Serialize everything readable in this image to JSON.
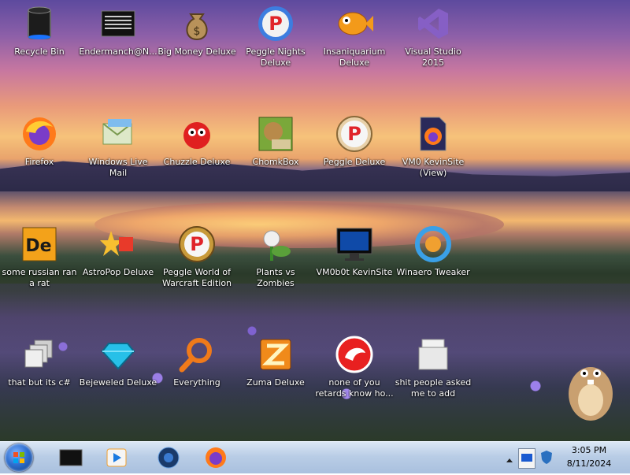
{
  "desktop": {
    "icons": [
      {
        "label": "Recycle Bin"
      },
      {
        "label": "Endermanch@N..."
      },
      {
        "label": "Big Money Deluxe"
      },
      {
        "label": "Peggle Nights Deluxe"
      },
      {
        "label": "Insaniquarium Deluxe"
      },
      {
        "label": "Visual Studio 2015"
      },
      {
        "label": "Firefox"
      },
      {
        "label": "Windows Live Mail"
      },
      {
        "label": "Chuzzle Deluxe"
      },
      {
        "label": "ChomkBox"
      },
      {
        "label": "Peggle Deluxe"
      },
      {
        "label": "VM0 KevinSite (View)"
      },
      {
        "label": "some russian ran a rat"
      },
      {
        "label": "AstroPop Deluxe"
      },
      {
        "label": "Peggle World of Warcraft Edition"
      },
      {
        "label": "Plants vs Zombies"
      },
      {
        "label": "VM0b0t KevinSite"
      },
      {
        "label": "Winaero Tweaker"
      },
      {
        "label": "that but its c#"
      },
      {
        "label": "Bejeweled Deluxe"
      },
      {
        "label": "Everything"
      },
      {
        "label": "Zuma Deluxe"
      },
      {
        "label": "none of you retards know ho..."
      },
      {
        "label": "shit people asked me to add"
      }
    ]
  },
  "taskbar": {
    "clock": {
      "time": "3:05 PM",
      "date": "8/11/2024"
    }
  }
}
